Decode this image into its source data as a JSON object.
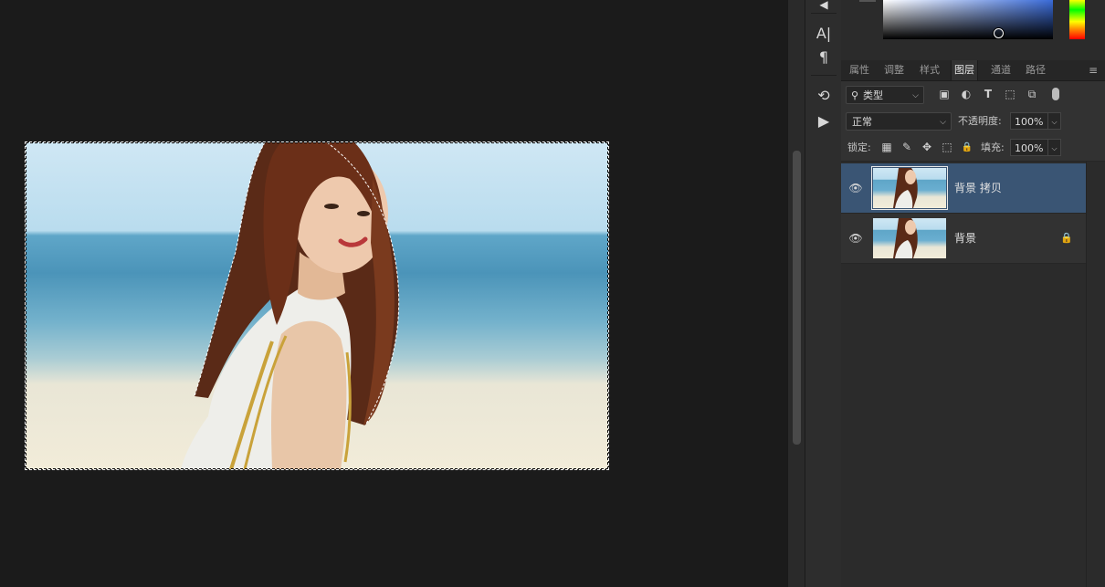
{
  "tool_strip": {
    "items": [
      {
        "name": "character-panel",
        "glyph": "A|"
      },
      {
        "name": "paragraph-panel",
        "glyph": "¶"
      },
      {
        "name": "history-panel",
        "glyph": "⟲"
      },
      {
        "name": "actions-panel",
        "glyph": "▶"
      }
    ]
  },
  "tabs": [
    {
      "label": "属性",
      "active": false
    },
    {
      "label": "调整",
      "active": false
    },
    {
      "label": "样式",
      "active": false
    },
    {
      "label": "图层",
      "active": true
    },
    {
      "label": "通道",
      "active": false
    },
    {
      "label": "路径",
      "active": false
    }
  ],
  "panel_menu_glyph": "≡",
  "filter": {
    "kind_label": "类型",
    "search_glyph": "⚲",
    "icons": [
      {
        "name": "image-filter-icon",
        "glyph": "▣"
      },
      {
        "name": "adjustment-filter-icon",
        "glyph": "◐"
      },
      {
        "name": "type-filter-icon",
        "glyph": "T"
      },
      {
        "name": "shape-filter-icon",
        "glyph": "⬚"
      },
      {
        "name": "smart-object-filter-icon",
        "glyph": "⧉"
      }
    ]
  },
  "blend": {
    "mode": "正常",
    "opacity_label": "不透明度:",
    "opacity_value": "100%"
  },
  "lock": {
    "label": "锁定:",
    "fill_label": "填充:",
    "fill_value": "100%",
    "icons": [
      {
        "name": "lock-transparent-pixels-icon",
        "glyph": "▦"
      },
      {
        "name": "lock-image-pixels-icon",
        "glyph": "✎"
      },
      {
        "name": "lock-position-icon",
        "glyph": "✥"
      },
      {
        "name": "prevent-autonest-icon",
        "glyph": "⬚"
      },
      {
        "name": "lock-all-icon",
        "glyph": "🔒"
      }
    ]
  },
  "layers": [
    {
      "name": "背景 拷贝",
      "selected": true,
      "locked": false
    },
    {
      "name": "背景",
      "selected": false,
      "locked": true
    }
  ],
  "glyphs": {
    "eye": "👁",
    "chevron": "⌵",
    "lock": "🔒"
  },
  "colors": {
    "canvas_bg": "#1b1b1b",
    "panel_bg": "#2b2b2b",
    "row_bg": "#323232",
    "selected_layer": "#3a5574"
  }
}
